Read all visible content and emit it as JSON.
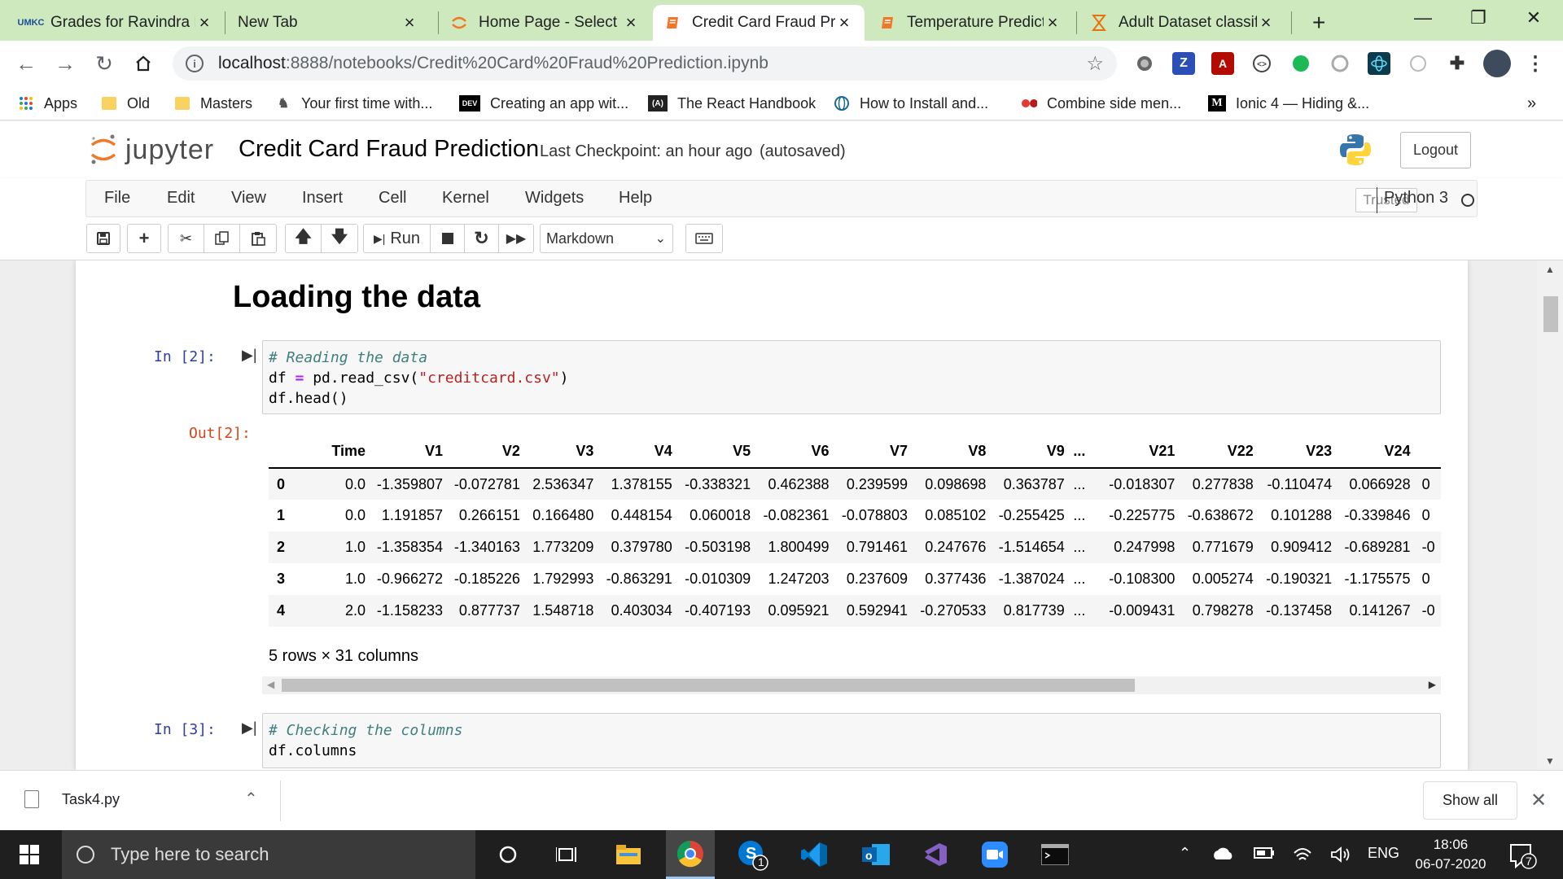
{
  "browser": {
    "tabs": [
      {
        "title": "Grades for Ravindra Kumar",
        "favicon": "umkc-icon",
        "active": false
      },
      {
        "title": "New Tab",
        "favicon": "none",
        "active": false
      },
      {
        "title": "Home Page - Select or create",
        "favicon": "jupyter-spinner-icon",
        "active": false
      },
      {
        "title": "Credit Card Fraud Prediction",
        "favicon": "jupyter-notebook-icon",
        "active": true
      },
      {
        "title": "Temperature Prediction",
        "favicon": "jupyter-notebook-icon",
        "active": false
      },
      {
        "title": "Adult Dataset classification",
        "favicon": "hourglass-icon",
        "active": false
      }
    ],
    "new_tab_symbol": "+",
    "window_controls": {
      "minimize": "—",
      "maximize": "❐",
      "close": "✕"
    },
    "address": {
      "host": "localhost",
      "path": ":8888/notebooks/Credit%20Card%20Fraud%20Prediction.ipynb"
    },
    "bookmarks": [
      {
        "label": "Apps",
        "icon": "apps-grid-icon"
      },
      {
        "label": "Old",
        "icon": "folder-icon"
      },
      {
        "label": "Masters",
        "icon": "folder-icon"
      },
      {
        "label": "Your first time with...",
        "icon": "person-icon"
      },
      {
        "label": "Creating an app wit...",
        "icon": "dev-icon"
      },
      {
        "label": "The React Handbook",
        "icon": "react-handbook-icon"
      },
      {
        "label": "How to Install and...",
        "icon": "globe-icon"
      },
      {
        "label": "Combine side men...",
        "icon": "dots-icon"
      },
      {
        "label": "Ionic 4 — Hiding &...",
        "icon": "medium-icon"
      }
    ],
    "bookmarks_overflow": "»"
  },
  "jupyter": {
    "logo_text": "jupyter",
    "notebook_title": "Credit Card Fraud Prediction",
    "checkpoint": "Last Checkpoint: an hour ago",
    "autosave": "(autosaved)",
    "logout_label": "Logout",
    "menu": [
      "File",
      "Edit",
      "View",
      "Insert",
      "Cell",
      "Kernel",
      "Widgets",
      "Help"
    ],
    "trusted_label": "Trusted",
    "kernel_name": "Python 3",
    "run_label": "Run",
    "cell_type": "Markdown"
  },
  "notebook": {
    "section_title": "Loading the data",
    "cell2": {
      "in_prompt": "In [2]:",
      "out_prompt": "Out[2]:",
      "comment": "# Reading the data",
      "line2_a": "df ",
      "line2_op": "=",
      "line2_b": " pd.read_csv(",
      "line2_str": "\"creditcard.csv\"",
      "line2_c": ")",
      "line3": "df.head()"
    },
    "dataframe": {
      "columns": [
        "Time",
        "V1",
        "V2",
        "V3",
        "V4",
        "V5",
        "V6",
        "V7",
        "V8",
        "V9",
        "...",
        "V21",
        "V22",
        "V23",
        "V24"
      ],
      "rows": [
        {
          "index": "0",
          "values": [
            "0.0",
            "-1.359807",
            "-0.072781",
            "2.536347",
            "1.378155",
            "-0.338321",
            "0.462388",
            "0.239599",
            "0.098698",
            "0.363787",
            "...",
            "-0.018307",
            "0.277838",
            "-0.110474",
            "0.066928"
          ],
          "clipped": "0"
        },
        {
          "index": "1",
          "values": [
            "0.0",
            "1.191857",
            "0.266151",
            "0.166480",
            "0.448154",
            "0.060018",
            "-0.082361",
            "-0.078803",
            "0.085102",
            "-0.255425",
            "...",
            "-0.225775",
            "-0.638672",
            "0.101288",
            "-0.339846"
          ],
          "clipped": "0"
        },
        {
          "index": "2",
          "values": [
            "1.0",
            "-1.358354",
            "-1.340163",
            "1.773209",
            "0.379780",
            "-0.503198",
            "1.800499",
            "0.791461",
            "0.247676",
            "-1.514654",
            "...",
            "0.247998",
            "0.771679",
            "0.909412",
            "-0.689281"
          ],
          "clipped": "-0"
        },
        {
          "index": "3",
          "values": [
            "1.0",
            "-0.966272",
            "-0.185226",
            "1.792993",
            "-0.863291",
            "-0.010309",
            "1.247203",
            "0.237609",
            "0.377436",
            "-1.387024",
            "...",
            "-0.108300",
            "0.005274",
            "-0.190321",
            "-1.175575"
          ],
          "clipped": "0"
        },
        {
          "index": "4",
          "values": [
            "2.0",
            "-1.158233",
            "0.877737",
            "1.548718",
            "0.403034",
            "-0.407193",
            "0.095921",
            "0.592941",
            "-0.270533",
            "0.817739",
            "...",
            "-0.009431",
            "0.798278",
            "-0.137458",
            "0.141267"
          ],
          "clipped": "-0"
        }
      ],
      "shape": "5 rows × 31 columns"
    },
    "cell3": {
      "in_prompt": "In [3]:",
      "comment": "# Checking the columns",
      "line2": "df.columns"
    }
  },
  "download_bar": {
    "file": "Task4.py",
    "show_all": "Show all"
  },
  "taskbar": {
    "search_placeholder": "Type here to search",
    "language": "ENG",
    "time": "18:06",
    "date": "06-07-2020",
    "skype_badge": "1",
    "notification_count": "7"
  },
  "colors": {
    "tabstrip": "#cfe9be",
    "jupyter_orange": "#f37726",
    "in_prompt": "#303f9f",
    "out_prompt": "#d84315"
  }
}
